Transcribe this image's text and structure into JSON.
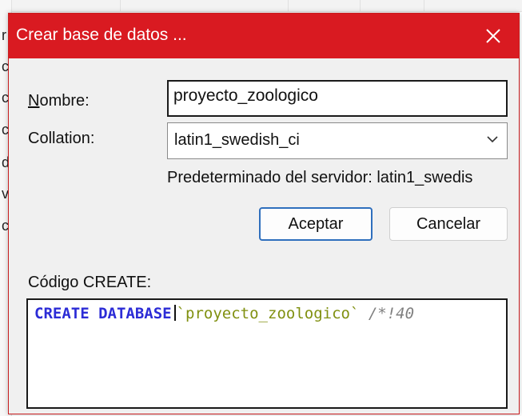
{
  "dialog": {
    "title": "Crear base de datos ...",
    "close_label": "✕"
  },
  "form": {
    "name_label_first": "N",
    "name_label_rest": "ombre:",
    "name_value": "proyecto_zoologico",
    "collation_label": "Collation:",
    "collation_value": "latin1_swedish_ci",
    "server_default": "Predeterminado del servidor: latin1_swedis"
  },
  "buttons": {
    "accept": "Aceptar",
    "cancel": "Cancelar"
  },
  "code": {
    "label": "Código CREATE:",
    "keyword1": "CREATE",
    "keyword2": "DATABASE",
    "name": "`proyecto_zoologico`",
    "comment": "/*!40"
  },
  "background": {
    "letters": [
      "r",
      "c",
      "c",
      "c",
      "d",
      "v",
      "c"
    ]
  },
  "colors": {
    "titlebar": "#d91a21",
    "accent": "#2f6fbd"
  }
}
